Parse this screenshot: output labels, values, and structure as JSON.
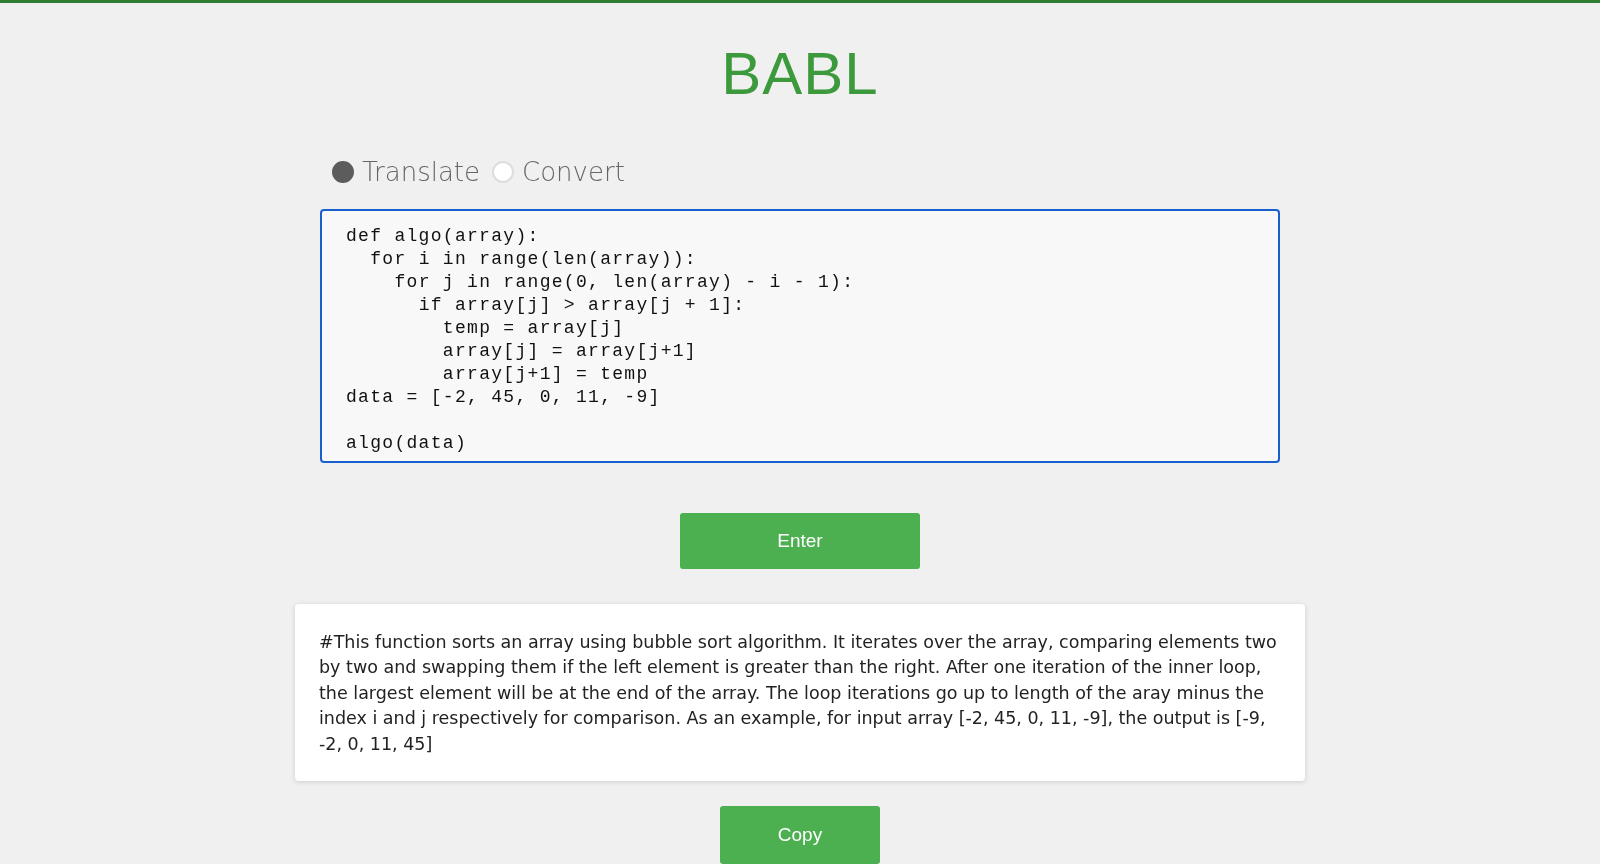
{
  "title": "BABL",
  "modes": [
    {
      "label": "Translate",
      "selected": true
    },
    {
      "label": "Convert",
      "selected": false
    }
  ],
  "code_input": {
    "value": "def algo(array):\n  for i in range(len(array)):\n    for j in range(0, len(array) - i - 1):\n      if array[j] > array[j + 1]:\n        temp = array[j]\n        array[j] = array[j+1]\n        array[j+1] = temp\ndata = [-2, 45, 0, 11, -9]\n\nalgo(data)"
  },
  "enter_button": "Enter",
  "output": "#This function sorts an array using bubble sort algorithm. It iterates over the array, comparing elements two by two and swapping them if the left element is greater than the right. After one iteration of the inner loop, the largest element will be at the end of the array. The loop iterations go up to length of the aray minus the index i and j respectively for comparison. As an example, for input array [-2, 45, 0, 11, -9], the output is [-9, -2, 0, 11, 45]",
  "copy_button": "Copy"
}
